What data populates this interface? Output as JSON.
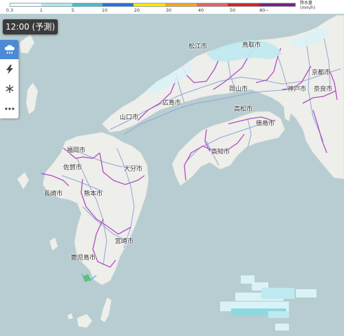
{
  "legend": {
    "ticks": [
      "0.3",
      "1",
      "5",
      "10",
      "20",
      "30",
      "40",
      "50",
      "80~"
    ],
    "unit_line1": "降水量",
    "unit_line2": "(mm/h)",
    "colors": [
      "#eef9fb",
      "#aee6f0",
      "#46bccc",
      "#2a6fd6",
      "#ffe600",
      "#f2a61e",
      "#e8606a",
      "#d12424",
      "#7b1f8c"
    ]
  },
  "time_badge": "12:00 (予測)",
  "toolbar": {
    "items": [
      {
        "icon": "rain-cloud-icon",
        "active": true
      },
      {
        "icon": "lightning-icon",
        "active": false
      },
      {
        "icon": "snowflake-icon",
        "active": false
      },
      {
        "icon": "more-icon",
        "active": false
      }
    ]
  },
  "cities": {
    "matsue": "松江市",
    "tottori": "鳥取市",
    "kyoto": "京都市",
    "kobe": "神戸市",
    "nara": "奈良市",
    "okayama": "岡山市",
    "hiroshima": "広島市",
    "yamaguchi": "山口市",
    "takamatsu": "高松市",
    "tokushima": "徳島市",
    "kochi": "高知市",
    "fukuoka": "福岡市",
    "saga": "佐賀市",
    "oita": "大分市",
    "nagasaki": "長崎市",
    "kumamoto": "熊本市",
    "miyazaki": "宮崎市",
    "kagoshima": "鹿児島市"
  },
  "colors": {
    "sea": "#b7cdd1",
    "land": "#eeeeea",
    "prefecture_border": "#b04cc4",
    "road": "#8ea6d8"
  }
}
